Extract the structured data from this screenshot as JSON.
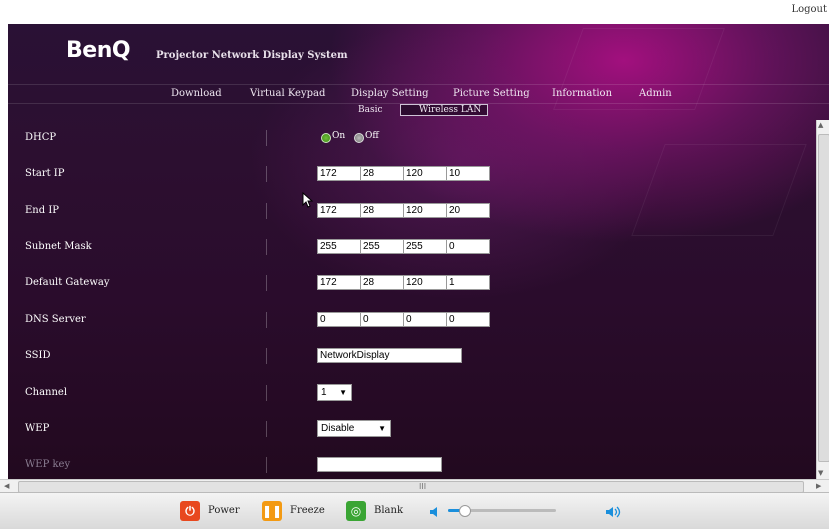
{
  "topbar": {
    "logout": "Logout"
  },
  "header": {
    "logo": "BenQ",
    "app_title": "Projector Network Display System"
  },
  "nav": {
    "items": [
      "Download",
      "Virtual Keypad",
      "Display Setting",
      "Picture Setting",
      "Information",
      "Admin"
    ]
  },
  "subnav": {
    "items": [
      "Basic",
      "Wireless LAN"
    ],
    "active": "Wireless LAN"
  },
  "form": {
    "dhcp": {
      "label": "DHCP",
      "on_label": "On",
      "off_label": "Off",
      "selected": "On"
    },
    "start_ip": {
      "label": "Start IP",
      "octets": [
        "172",
        "28",
        "120",
        "10"
      ]
    },
    "end_ip": {
      "label": "End IP",
      "octets": [
        "172",
        "28",
        "120",
        "20"
      ]
    },
    "subnet_mask": {
      "label": "Subnet Mask",
      "octets": [
        "255",
        "255",
        "255",
        "0"
      ]
    },
    "default_gateway": {
      "label": "Default Gateway",
      "octets": [
        "172",
        "28",
        "120",
        "1"
      ]
    },
    "dns_server": {
      "label": "DNS Server",
      "octets": [
        "0",
        "0",
        "0",
        "0"
      ]
    },
    "ssid": {
      "label": "SSID",
      "value": "NetworkDisplay"
    },
    "channel": {
      "label": "Channel",
      "value": "1"
    },
    "wep": {
      "label": "WEP",
      "value": "Disable"
    },
    "wep_key": {
      "label": "WEP key",
      "value": ""
    }
  },
  "scrollbar": {
    "grip": "III"
  },
  "controls": {
    "power": "Power",
    "freeze": "Freeze",
    "blank": "Blank",
    "volume_level": 0.15,
    "colors": {
      "power": "#e8481e",
      "freeze": "#f39a13",
      "blank": "#3aa534",
      "volume": "#1a8fdc"
    }
  }
}
